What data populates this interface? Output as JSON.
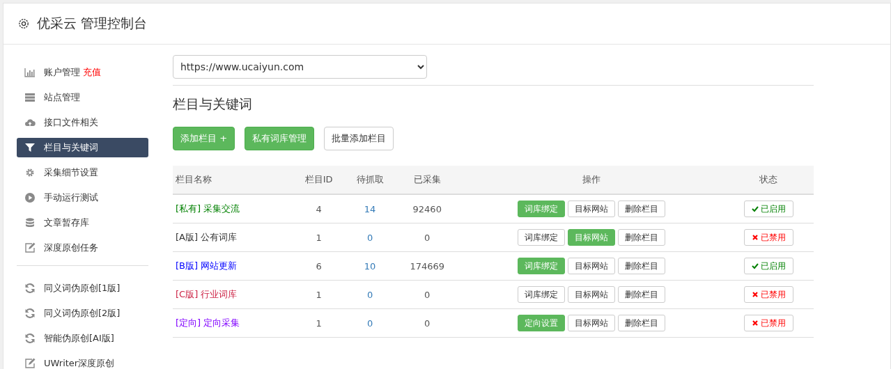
{
  "header": {
    "title": "优采云 管理控制台"
  },
  "sidebar": {
    "groups": [
      [
        {
          "kind": "chart",
          "label": "账户管理",
          "badge": "充值",
          "selected": false
        },
        {
          "kind": "server",
          "label": "站点管理",
          "selected": false
        },
        {
          "kind": "cloud",
          "label": "接口文件相关",
          "selected": false
        },
        {
          "kind": "filter",
          "label": "栏目与关键词",
          "selected": true
        },
        {
          "kind": "gear",
          "label": "采集细节设置",
          "selected": false
        },
        {
          "kind": "play",
          "label": "手动运行测试",
          "selected": false
        },
        {
          "kind": "database",
          "label": "文章暂存库",
          "selected": false
        },
        {
          "kind": "edit",
          "label": "深度原创任务",
          "selected": false
        }
      ],
      [
        {
          "kind": "refresh",
          "label": "同义词伪原创[1版]",
          "selected": false
        },
        {
          "kind": "refresh",
          "label": "同义词伪原创[2版]",
          "selected": false
        },
        {
          "kind": "refresh",
          "label": "智能伪原创[AI版]",
          "selected": false
        },
        {
          "kind": "edit",
          "label": "UWriter深度原创",
          "selected": false
        }
      ]
    ]
  },
  "site_select": {
    "value": "https://www.ucaiyun.com"
  },
  "section_title": "栏目与关键词",
  "actions": [
    {
      "label": "添加栏目 +",
      "primary": true
    },
    {
      "label": "私有词库管理",
      "primary": true
    },
    {
      "label": "批量添加栏目",
      "primary": false
    }
  ],
  "table": {
    "columns": [
      "栏目名称",
      "栏目ID",
      "待抓取",
      "已采集",
      "操作",
      "状态"
    ],
    "rows": [
      {
        "tag": "[私有]",
        "name": "采集交流",
        "color": "#008000",
        "id": "4",
        "pending": "14",
        "collected": "92460",
        "ops": [
          {
            "label": "词库绑定",
            "selected": true
          },
          {
            "label": "目标网站",
            "selected": false
          },
          {
            "label": "删除栏目",
            "selected": false
          }
        ],
        "enabled": true,
        "status": "已启用"
      },
      {
        "tag": "[A版]",
        "name": "公有词库",
        "color": "#333333",
        "id": "1",
        "pending": "0",
        "collected": "0",
        "ops": [
          {
            "label": "词库绑定",
            "selected": false
          },
          {
            "label": "目标网站",
            "selected": true
          },
          {
            "label": "删除栏目",
            "selected": false
          }
        ],
        "enabled": false,
        "status": "已禁用"
      },
      {
        "tag": "[B版]",
        "name": "网站更新",
        "color": "#0000ff",
        "id": "6",
        "pending": "10",
        "collected": "174669",
        "ops": [
          {
            "label": "词库绑定",
            "selected": true
          },
          {
            "label": "目标网站",
            "selected": false
          },
          {
            "label": "删除栏目",
            "selected": false
          }
        ],
        "enabled": true,
        "status": "已启用"
      },
      {
        "tag": "[C版]",
        "name": "行业词库",
        "color": "#cc2244",
        "id": "1",
        "pending": "0",
        "collected": "0",
        "ops": [
          {
            "label": "词库绑定",
            "selected": false
          },
          {
            "label": "目标网站",
            "selected": false
          },
          {
            "label": "删除栏目",
            "selected": false
          }
        ],
        "enabled": false,
        "status": "已禁用"
      },
      {
        "tag": "[定向]",
        "name": "定向采集",
        "color": "#8000ff",
        "id": "1",
        "pending": "0",
        "collected": "0",
        "ops": [
          {
            "label": "定向设置",
            "selected": true
          },
          {
            "label": "目标网站",
            "selected": false
          },
          {
            "label": "删除栏目",
            "selected": false
          }
        ],
        "enabled": false,
        "status": "已禁用"
      }
    ]
  }
}
